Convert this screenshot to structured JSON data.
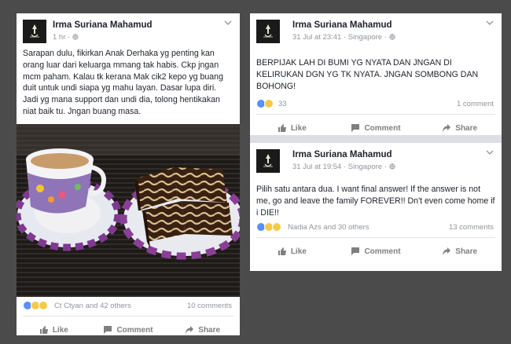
{
  "posts": [
    {
      "author": "Irma Suriana Mahamud",
      "time": "1 hr",
      "text": "Sarapan dulu, fikirkan Anak Derhaka yg penting kan orang luar dari keluarga mmang tak habis. Ckp jngan mcm paham. Kalau tk kerana Mak cik2 kepo yg buang duit untuk undi siapa yg mahu layan. Dasar lupa diri. Jadi yg mana support dan undi dia, tolong hentikakan niat baik tu. Jngan buang masa.",
      "reactions_text": "Ct Ctyan and 42 others",
      "comments": "10 comments",
      "actions": {
        "like": "Like",
        "comment": "Comment",
        "share": "Share"
      }
    },
    {
      "author": "Irma Suriana Mahamud",
      "time": "31 Jul at 23:41",
      "location": "Singapore",
      "text": "BERPIJAK LAH DI BUMI YG NYATA DAN JNGAN DI KELIRUKAN DGN YG TK NYATA. JNGAN SOMBONG DAN BOHONG!",
      "reactions_text": "33",
      "comments": "1 comment",
      "actions": {
        "like": "Like",
        "comment": "Comment",
        "share": "Share"
      }
    },
    {
      "author": "Irma Suriana Mahamud",
      "time": "31 Jul at 19:54",
      "location": "Singapore",
      "text": "Pilih satu antara dua. I want final answer! If the answer is not me, go and leave the family FOREVER!! Dn't even come home if i DIE!!",
      "reactions_text": "Nadia Azs and 30 others",
      "comments": "13 comments",
      "actions": {
        "like": "Like",
        "comment": "Comment",
        "share": "Share"
      }
    }
  ],
  "meta_separator": "·",
  "colors": {
    "like_blue": "#5890ff",
    "emoji_yellow": "#f7c94b",
    "meta_grey": "#90949c",
    "text": "#1d2129"
  },
  "icons": [
    "globe-icon",
    "chevron-down-icon",
    "like-icon",
    "comment-icon",
    "share-icon",
    "like-reaction-icon",
    "sad-reaction-icon",
    "wow-reaction-icon"
  ]
}
